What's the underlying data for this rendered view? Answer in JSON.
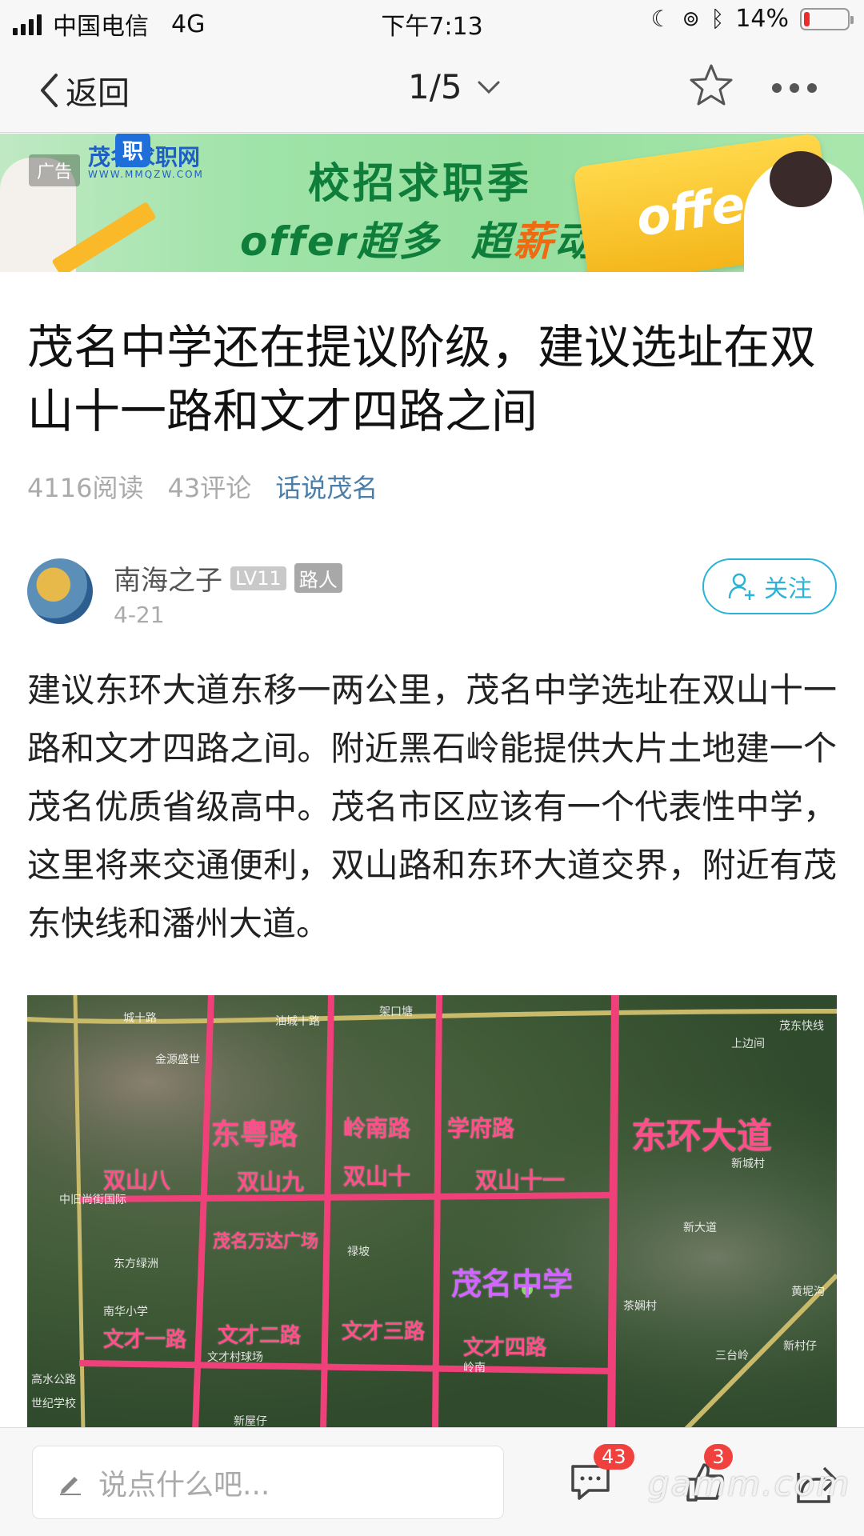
{
  "status_bar": {
    "carrier": "中国电信",
    "network": "4G",
    "time": "下午7:13",
    "battery": "14%",
    "battery_level": 0.14
  },
  "nav": {
    "back_label": "返回",
    "pager": "1/5"
  },
  "ad": {
    "tag": "广告",
    "brand": "茂名求职网",
    "brand_url": "WWW.MMQZW.COM",
    "headline": "校招求职季",
    "subline_a": "offer超多",
    "subline_b": "超",
    "subline_hot": "薪",
    "subline_c": "动",
    "offer_word": "offer"
  },
  "article": {
    "title": "茂名中学还在提议阶级，建议选址在双山十一路和文才四路之间",
    "reads": "4116阅读",
    "comments": "43评论",
    "topic": "话说茂名",
    "body": "建议东环大道东移一两公里，茂名中学选址在双山十一路和文才四路之间。附近黑石岭能提供大片土地建一个茂名优质省级高中。茂名市区应该有一个代表性中学，这里将来交通便利，双山路和东环大道交界，附近有茂东快线和潘州大道。"
  },
  "author": {
    "name": "南海之子",
    "level": "LV11",
    "role": "路人",
    "date": "4-21",
    "follow_label": "关注"
  },
  "map": {
    "labels": {
      "east_ring": "东环大道",
      "dongyue": "东粤路",
      "lingnan": "岭南路",
      "xuefu": "学府路",
      "shuangshan8": "双山八",
      "shuangshan9": "双山九",
      "shuangshan10": "双山十",
      "shuangshan11": "双山十一",
      "wanda": "茂名万达广场",
      "school": "茂名中学",
      "wencai1": "文才一路",
      "wencai2": "文才二路",
      "wencai3": "文才三路",
      "wencai4": "文才四路"
    },
    "small_labels": {
      "a": "城十路",
      "b": "油城十路",
      "c": "架口塘",
      "d": "茂东快线",
      "e": "金源盛世",
      "f": "新城村",
      "g": "东方绿洲",
      "h": "茶娴村",
      "i": "三台岭",
      "j": "新村仔",
      "k": "新屋仔",
      "l": "高水公路",
      "m": "世纪学校",
      "n": "新大道",
      "o": "上边间",
      "p": "黄坭沟",
      "q": "禄坡",
      "r": "岭南",
      "s": "文才村球场",
      "t": "南华小学",
      "u": "中旧尚街国际"
    }
  },
  "bottom": {
    "input_placeholder": "说点什么吧...",
    "comment_count": "43",
    "like_count": "3"
  },
  "watermark": "gamm.com"
}
